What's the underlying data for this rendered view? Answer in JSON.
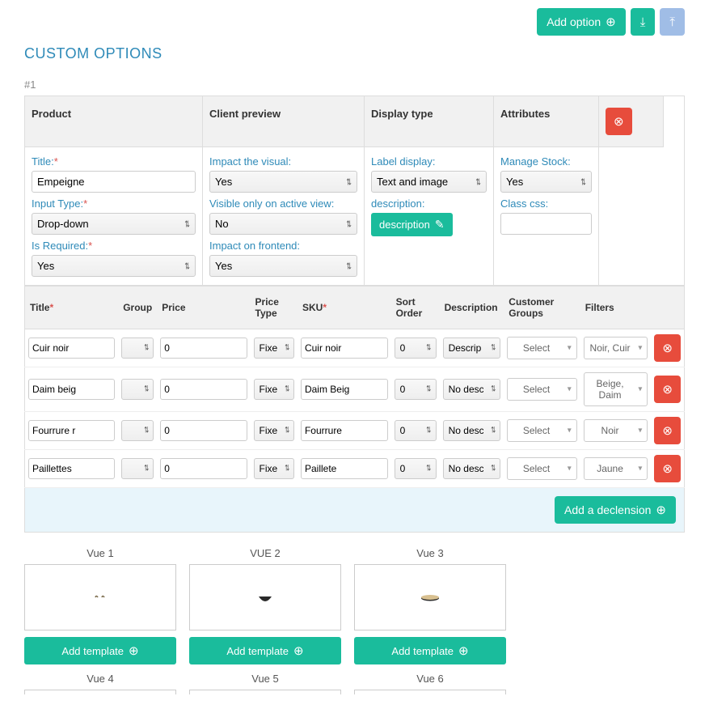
{
  "buttons": {
    "add_option": "Add option",
    "description": "description",
    "add_declension": "Add a declension",
    "add_template": "Add template"
  },
  "page_title": "CUSTOM OPTIONS",
  "option_number": "#1",
  "panel_headers": {
    "product": "Product",
    "client_preview": "Client preview",
    "display_type": "Display type",
    "attributes": "Attributes"
  },
  "product": {
    "title_label": "Title:",
    "title_value": "Empeigne",
    "input_type_label": "Input Type:",
    "input_type_value": "Drop-down",
    "is_required_label": "Is Required:",
    "is_required_value": "Yes"
  },
  "client_preview": {
    "impact_visual_label": "Impact the visual:",
    "impact_visual_value": "Yes",
    "visible_active_label": "Visible only on active view:",
    "visible_active_value": "No",
    "impact_frontend_label": "Impact on frontend:",
    "impact_frontend_value": "Yes"
  },
  "display_type": {
    "label_display_label": "Label display:",
    "label_display_value": "Text and image",
    "description_label": "description:"
  },
  "attributes": {
    "manage_stock_label": "Manage Stock:",
    "manage_stock_value": "Yes",
    "class_css_label": "Class css:",
    "class_css_value": ""
  },
  "table_headers": {
    "title": "Title",
    "group": "Group",
    "price": "Price",
    "price_type": "Price Type",
    "sku": "SKU",
    "sort_order": "Sort Order",
    "description": "Description",
    "customer_groups": "Customer Groups",
    "filters": "Filters"
  },
  "rows": [
    {
      "title": "Cuir noir",
      "group": "",
      "price": "0",
      "price_type": "Fixed",
      "sku": "Cuir noir",
      "sort": "0",
      "desc": "Descrip",
      "cg": "Select",
      "filters": "Noir, Cuir"
    },
    {
      "title": "Daim beig",
      "group": "",
      "price": "0",
      "price_type": "Fixed",
      "sku": "Daim Beig",
      "sort": "0",
      "desc": "No desc",
      "cg": "Select",
      "filters": "Beige, Daim"
    },
    {
      "title": "Fourrure r",
      "group": "",
      "price": "0",
      "price_type": "Fixed",
      "sku": "Fourrure",
      "sort": "0",
      "desc": "No desc",
      "cg": "Select",
      "filters": "Noir"
    },
    {
      "title": "Paillettes",
      "group": "",
      "price": "0",
      "price_type": "Fixed",
      "sku": "Paillete",
      "sort": "0",
      "desc": "No desc",
      "cg": "Select",
      "filters": "Jaune"
    }
  ],
  "views": [
    "Vue 1",
    "VUE 2",
    "Vue 3",
    "Vue 4",
    "Vue 5",
    "Vue 6"
  ]
}
